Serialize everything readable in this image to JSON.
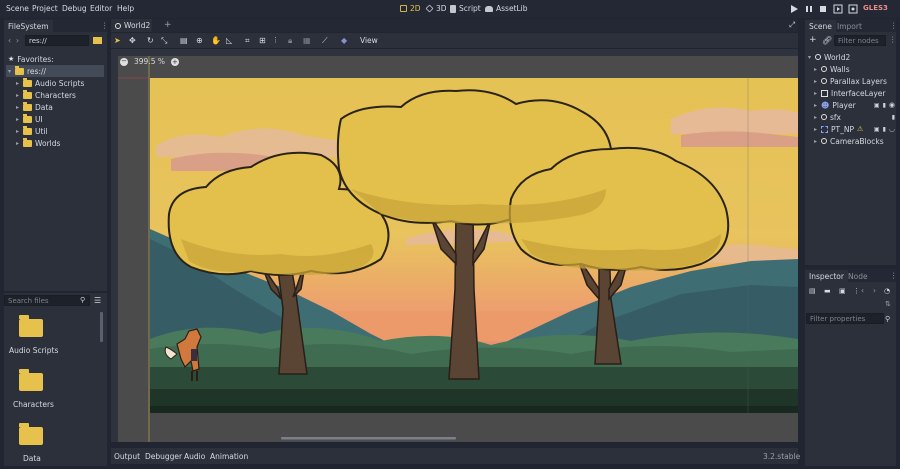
{
  "menu": [
    "Scene",
    "Project",
    "Debug",
    "Editor",
    "Help"
  ],
  "modes": [
    {
      "label": "2D",
      "icon": "2d-icon",
      "active": true
    },
    {
      "label": "3D",
      "icon": "3d-icon",
      "active": false
    },
    {
      "label": "Script",
      "icon": "script-icon",
      "active": false
    },
    {
      "label": "AssetLib",
      "icon": "assetlib-icon",
      "active": false
    }
  ],
  "renderer": "GLES3",
  "filesystem": {
    "tab": "FileSystem",
    "path": "res://",
    "favorites_label": "Favorites:",
    "root": "res://",
    "folders": [
      "Audio Scripts",
      "Characters",
      "Data",
      "UI",
      "Util",
      "Worlds"
    ],
    "search_placeholder": "Search files",
    "grid_items": [
      "Audio Scripts",
      "Characters",
      "Data"
    ]
  },
  "scene_tab": "World2",
  "toolbar": {
    "view_label": "View"
  },
  "zoom": "399.5 %",
  "bottom_tabs": [
    "Output",
    "Debugger",
    "Audio",
    "Animation"
  ],
  "version": "3.2.stable",
  "scene_dock": {
    "tabs": [
      "Scene",
      "Import"
    ],
    "filter_placeholder": "Filter nodes",
    "root": "World2",
    "nodes": [
      "Walls",
      "Parallax Layers",
      "InterfaceLayer",
      "Player",
      "sfx",
      "PT_NP",
      "CameraBlocks"
    ]
  },
  "inspector": {
    "tabs": [
      "Inspector",
      "Node"
    ],
    "filter_placeholder": "Filter properties"
  },
  "colors": {
    "accent": "#e6c24d",
    "bg": "#202531",
    "panel": "#2b303b",
    "warning": "#e8c93c"
  }
}
